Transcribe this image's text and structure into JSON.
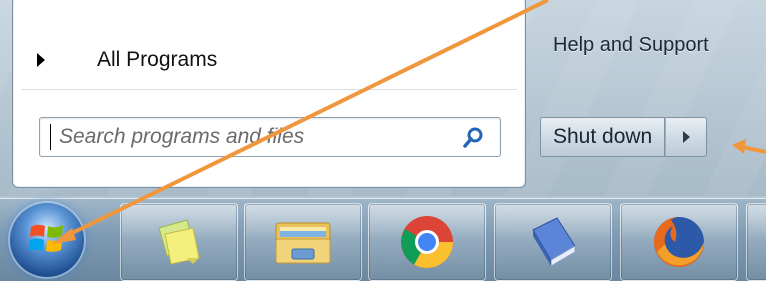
{
  "start_menu": {
    "all_programs_label": "All Programs",
    "search_placeholder": "Search programs and files",
    "help_support_label": "Help and Support",
    "shutdown_label": "Shut down"
  },
  "taskbar": {
    "pinned": [
      "start-orb",
      "sticky-notes",
      "windows-explorer",
      "google-chrome",
      "ebook",
      "firefox"
    ]
  },
  "annotation": {
    "arrow_color": "#f0963c"
  },
  "icons": [
    "search-icon",
    "windows-logo-icon",
    "sticky-notes-icon",
    "folder-icon",
    "chrome-icon",
    "book-icon",
    "firefox-icon"
  ]
}
